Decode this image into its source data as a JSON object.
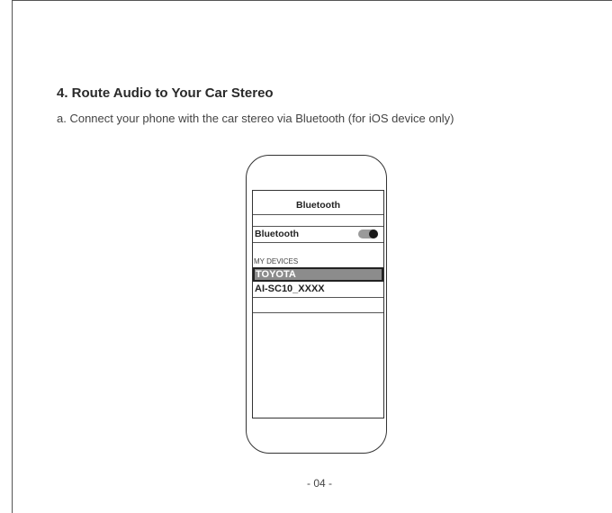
{
  "heading": "4. Route Audio to Your Car Stereo",
  "step_a": "a.  Connect your phone with the car stereo via Bluetooth (for iOS device only)",
  "phone": {
    "screen_title": "Bluetooth",
    "bluetooth_label": "Bluetooth",
    "bluetooth_on": true,
    "section_label": "MY DEVICES",
    "devices": [
      {
        "name": "TOYOTA",
        "selected": true
      },
      {
        "name": "AI-SC10_XXXX",
        "selected": false
      }
    ]
  },
  "page_number": "- 04 -"
}
